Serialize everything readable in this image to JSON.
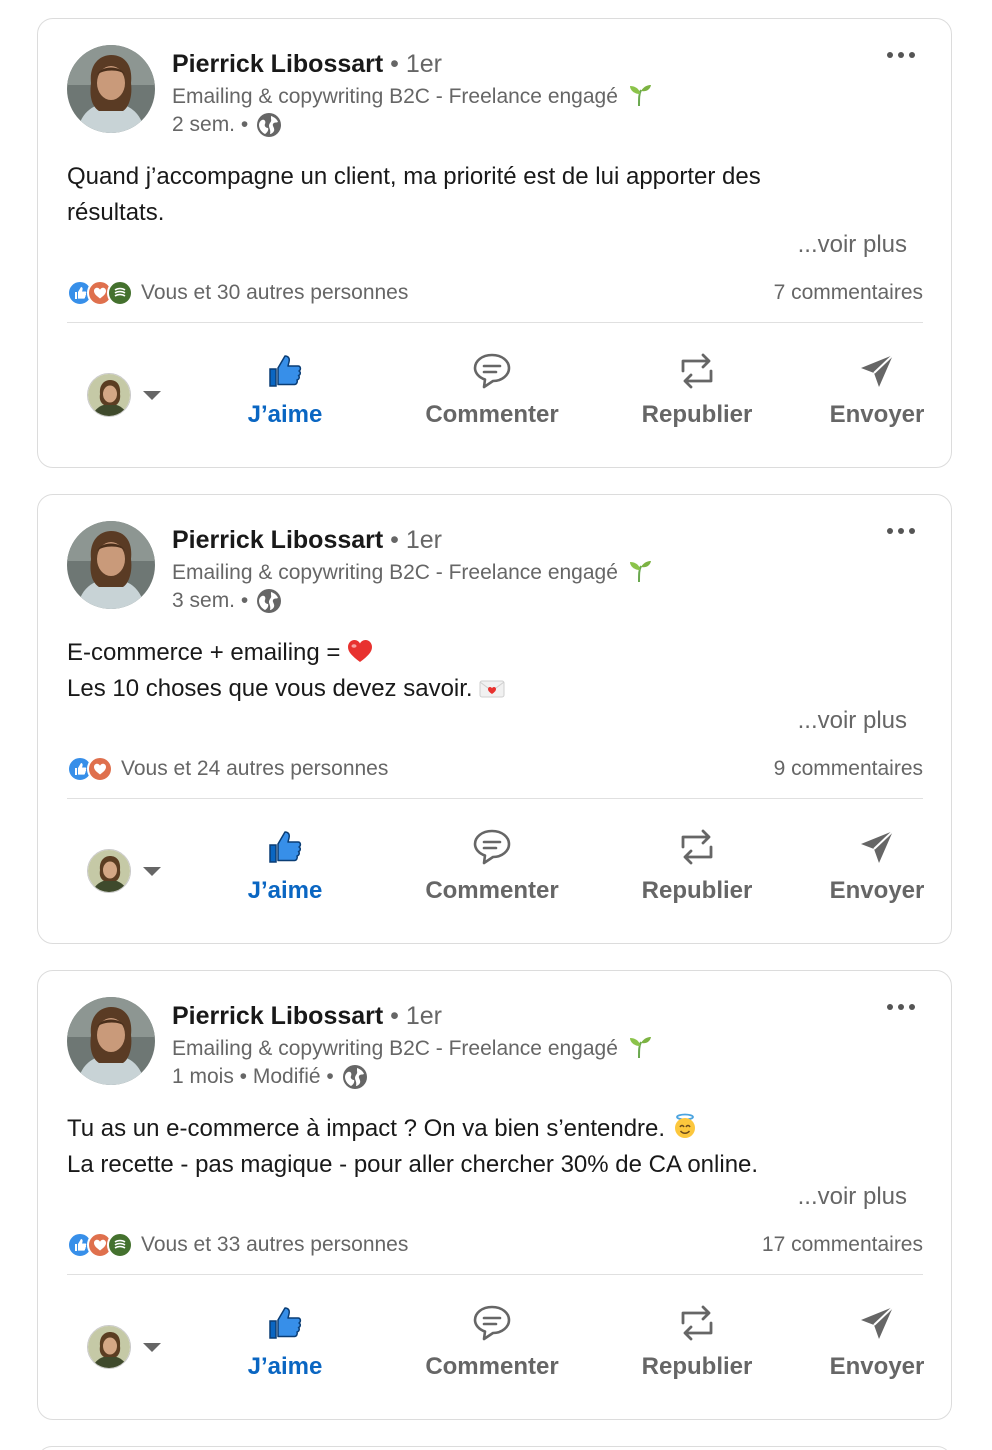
{
  "posts": [
    {
      "author": "Pierrick Libossart",
      "degree": "• 1er",
      "headline": "Emailing & copywriting B2C - Freelance engagé",
      "time": "2 sem. •",
      "lines": [
        "Quand j’accompagne un client, ma priorité est de lui apporter des",
        "résultats."
      ],
      "see_more": "...voir plus",
      "reactions_text": "Vous et 30 autres personnes",
      "reaction_icons": [
        "like-icon",
        "love-icon",
        "support-icon"
      ],
      "comments": "7 commentaires"
    },
    {
      "author": "Pierrick Libossart",
      "degree": "• 1er",
      "headline": "Emailing & copywriting B2C - Freelance engagé",
      "time": "3 sem. •",
      "lines": [
        "E-commerce + emailing = ",
        "Les 10 choses que vous devez savoir. "
      ],
      "see_more": "...voir plus",
      "reactions_text": "Vous et 24 autres personnes",
      "reaction_icons": [
        "like-icon",
        "love-icon"
      ],
      "comments": "9 commentaires"
    },
    {
      "author": "Pierrick Libossart",
      "degree": "• 1er",
      "headline": "Emailing & copywriting B2C - Freelance engagé",
      "time": "1 mois • Modifié •",
      "lines": [
        "Tu as un e-commerce à impact ? On va bien s’entendre. ",
        "La recette - pas magique - pour aller chercher 30% de CA online."
      ],
      "see_more": "...voir plus",
      "reactions_text": "Vous et 33 autres personnes",
      "reaction_icons": [
        "like-icon",
        "love-icon",
        "support-icon"
      ],
      "comments": "17 commentaires"
    }
  ],
  "actions": {
    "like": "J’aime",
    "comment": "Commenter",
    "repost": "Republier",
    "send": "Envoyer"
  },
  "colors": {
    "accent": "#0a66c2",
    "muted": "#666666",
    "border": "#dcdcdc"
  }
}
